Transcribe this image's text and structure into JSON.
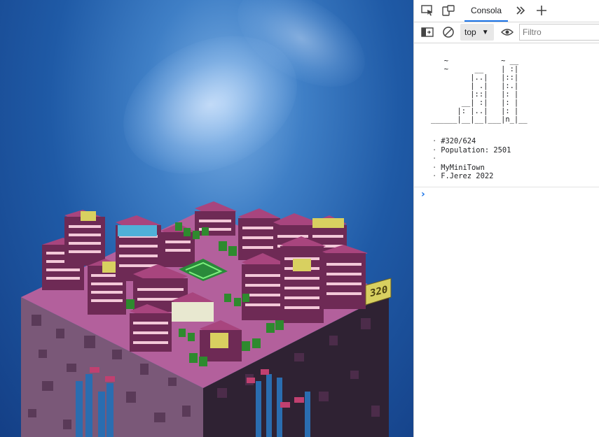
{
  "devtools": {
    "tabs": [
      {
        "name": "inspect-element",
        "icon": "cursor-in-box-icon"
      },
      {
        "name": "device-emulation",
        "icon": "device-toggle-icon"
      }
    ],
    "active_tab_label": "Consola",
    "more_tabs_icon": "chevron-double-right-icon",
    "add_tab_icon": "plus-icon",
    "toolbar": {
      "sidebar_icon": "sidebar-toggle-icon",
      "clear_icon": "no-entry-icon",
      "context_value": "top",
      "live_expression_icon": "eye-icon",
      "filter_placeholder": "Filtro"
    },
    "console": {
      "ascii_art": "   ~            ~ __\n   ~      __    | :|\n         |..|   |::|\n         | .|   |:.|\n         |::|   |: |\n       __| :|   |: |\n      |: |..|   |: |\n______|__|__|___|n_|__",
      "lines": [
        "#320/624",
        "Population: 2501",
        "",
        "MyMiniTown",
        "F.Jerez 2022"
      ],
      "prompt_symbol": "›"
    },
    "accent_color": "#1a73e8"
  },
  "scene": {
    "sign_number": "320",
    "palette": {
      "sky_top": "#143f86",
      "sky_light": "#7fb2e6",
      "roof": "#a8457e",
      "wall": "#6e2a55",
      "base_top": "#b3609c",
      "base_left": "#7a5878",
      "base_right": "#3a2a3c",
      "tree": "#2e8a2e",
      "sign": "#d8d060"
    }
  }
}
